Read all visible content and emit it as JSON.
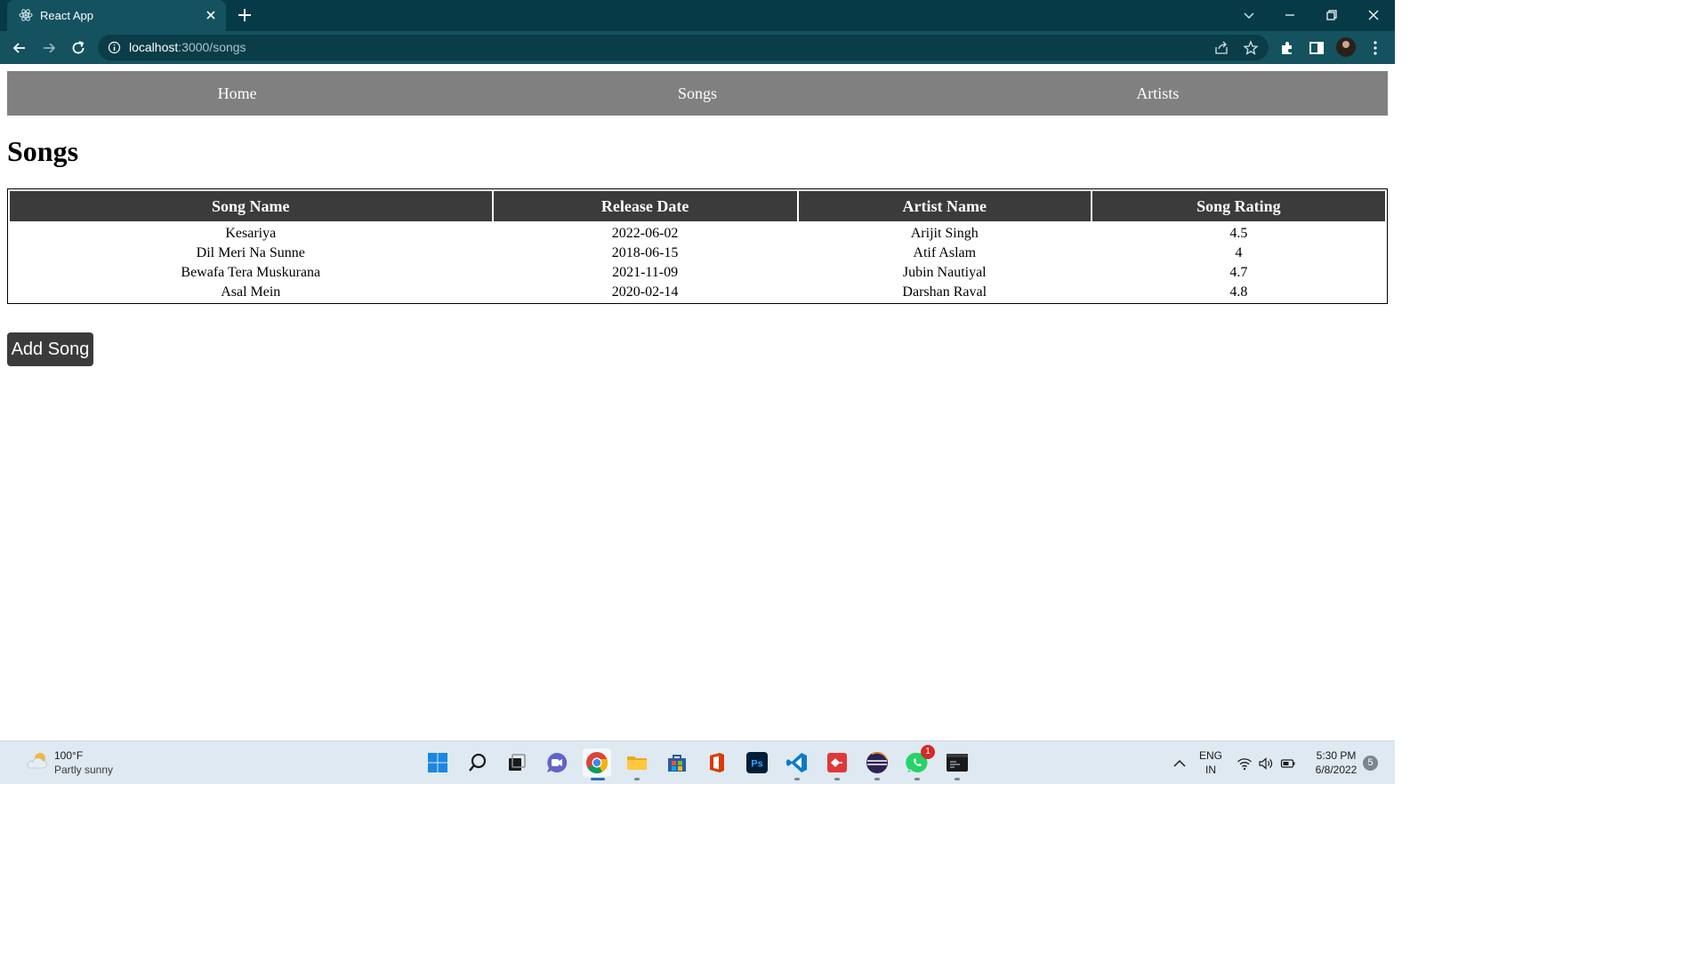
{
  "browser": {
    "tab_title": "React App",
    "url_host": "localhost",
    "url_path": ":3000/songs"
  },
  "nav": {
    "home": "Home",
    "songs": "Songs",
    "artists": "Artists"
  },
  "page": {
    "title": "Songs",
    "add_button": "Add Song"
  },
  "table": {
    "headers": [
      "Song Name",
      "Release Date",
      "Artist Name",
      "Song Rating"
    ],
    "rows": [
      [
        "Kesariya",
        "2022-06-02",
        "Arijit Singh",
        "4.5"
      ],
      [
        "Dil Meri Na Sunne",
        "2018-06-15",
        "Atif Aslam",
        "4"
      ],
      [
        "Bewafa Tera Muskurana",
        "2021-11-09",
        "Jubin Nautiyal",
        "4.7"
      ],
      [
        "Asal Mein",
        "2020-02-14",
        "Darshan Raval",
        "4.8"
      ]
    ]
  },
  "taskbar": {
    "weather_temp": "100°F",
    "weather_desc": "Partly sunny",
    "whatsapp_badge": "1",
    "lang_top": "ENG",
    "lang_bottom": "IN",
    "time": "5:30 PM",
    "date": "6/8/2022",
    "notification_count": "5"
  },
  "colors": {
    "tabbar_bg": "#063a47",
    "toolbar_bg": "#14525f",
    "navbar_bg": "#808080",
    "table_header_bg": "#3b3b3b",
    "button_bg": "#3b3b3b"
  }
}
